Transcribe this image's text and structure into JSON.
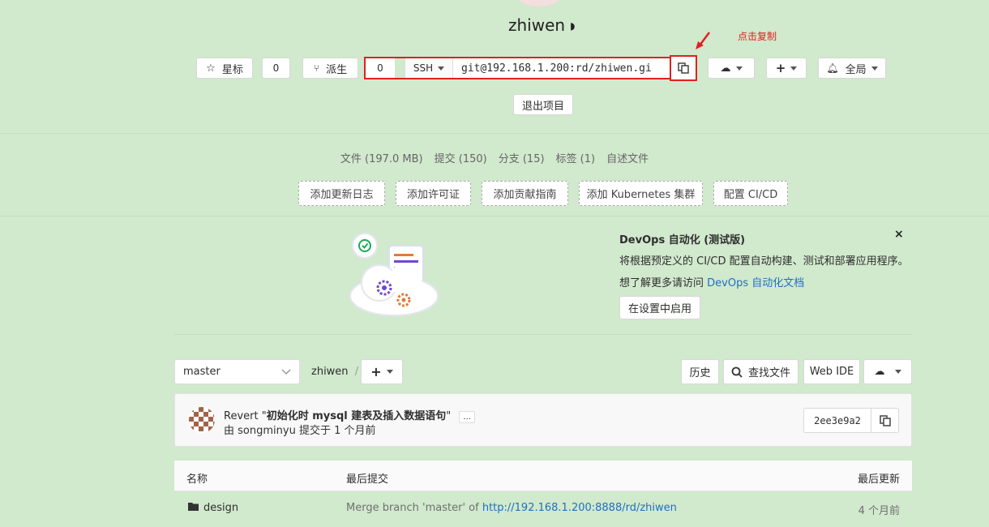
{
  "project": {
    "name": "zhiwen",
    "visibility_icon": "shield-icon"
  },
  "annotation": {
    "text": "点击复制"
  },
  "toolbar": {
    "star_label": "星标",
    "star_count": "0",
    "fork_label": "派生",
    "clone_count": "0",
    "clone_protocol": "SSH",
    "clone_url": "git@192.168.1.200:rd/zhiwen.gi",
    "notification_label": "全局",
    "leave_label": "退出项目"
  },
  "stats": [
    "文件 (197.0 MB)",
    "提交 (150)",
    "分支 (15)",
    "标签 (1)",
    "自述文件"
  ],
  "quick_actions": [
    "添加更新日志",
    "添加许可证",
    "添加贡献指南",
    "添加 Kubernetes 集群",
    "配置 CI/CD"
  ],
  "devops": {
    "title": "DevOps 自动化 (测试版)",
    "description": "将根据预定义的 CI/CD 配置自动构建、测试和部署应用程序。",
    "more_prefix": "想了解更多请访问",
    "more_link": "DevOps 自动化文档",
    "enable_label": "在设置中启用",
    "close_label": "×"
  },
  "repo_nav": {
    "branch": "master",
    "path_root": "zhiwen",
    "path_sep": "/",
    "history_label": "历史",
    "find_file_label": "查找文件",
    "web_ide_label": "Web IDE"
  },
  "last_commit": {
    "message_prefix": "Revert \"",
    "message_bold": "初始化时 mysql 建表及插入数据语句",
    "message_suffix": "\"",
    "ellipsis": "...",
    "meta_prefix": "由",
    "author": "songminyu",
    "meta_suffix": "提交于 1 个月前",
    "sha": "2ee3e9a2"
  },
  "file_table": {
    "columns": [
      "名称",
      "最后提交",
      "最后更新"
    ],
    "rows": [
      {
        "name": "design",
        "commit_prefix": "Merge branch 'master' of ",
        "commit_link": "http://192.168.1.200:8888/rd/zhiwen",
        "updated": "4 个月前"
      }
    ]
  }
}
